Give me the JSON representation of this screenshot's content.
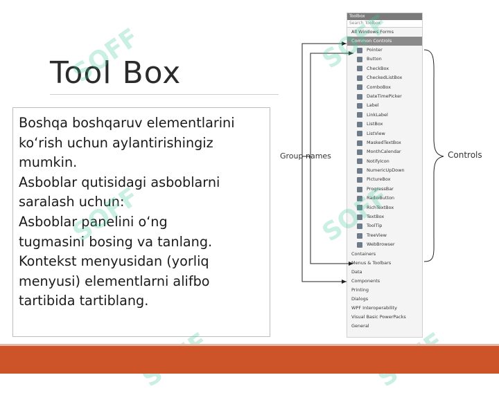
{
  "slide": {
    "title": "Tool Box",
    "body_lines": [
      "Boshqa boshqaruv elementlarini",
      "ko‘rish uchun aylantirishingiz",
      "mumkin.",
      "Asboblar qutisidagi asboblarni",
      "saralash uchun:",
      "Asboblar panelini o‘ng",
      "tugmasini bosing va tanlang.",
      "Kontekst menyusidan (yorliq",
      "menyusi) elementlarni alifbo",
      "tartibida tartiblang."
    ]
  },
  "toolbox": {
    "header": "Toolbox",
    "search_placeholder": "Search Toolbox",
    "top_group": "All Windows Forms",
    "active_group": "Common Controls",
    "items": [
      "Pointer",
      "Button",
      "CheckBox",
      "CheckedListBox",
      "ComboBox",
      "DateTimePicker",
      "Label",
      "LinkLabel",
      "ListBox",
      "ListView",
      "MaskedTextBox",
      "MonthCalendar",
      "NotifyIcon",
      "NumericUpDown",
      "PictureBox",
      "ProgressBar",
      "RadioButton",
      "RichTextBox",
      "TextBox",
      "ToolTip",
      "TreeView",
      "WebBrowser"
    ],
    "groups_after": [
      "Containers",
      "Menus & Toolbars",
      "Data",
      "Components",
      "Printing",
      "Dialogs",
      "WPF Interoperability",
      "Visual Basic PowerPacks",
      "General"
    ]
  },
  "annotations": {
    "group_names": "Group names",
    "controls": "Controls"
  },
  "watermark": "SOFF",
  "colors": {
    "footer": "#cc5428",
    "watermark": "#3cc896"
  }
}
